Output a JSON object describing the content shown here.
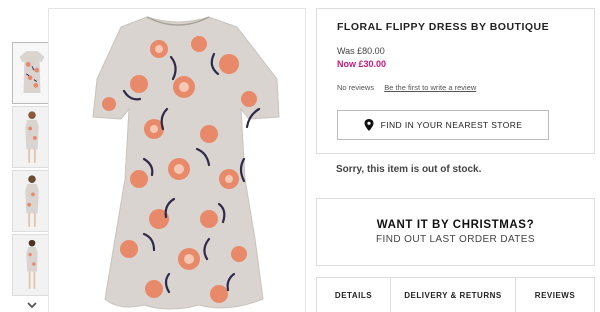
{
  "product": {
    "title": "FLORAL FLIPPY DRESS BY BOUTIQUE",
    "was_price": "Was £80.00",
    "now_price": "Now £30.00",
    "reviews_text": "No reviews",
    "review_link": "Be the first to write a review",
    "store_button": "FIND IN YOUR NEAREST STORE",
    "stock_message": "Sorry, this item is out of stock."
  },
  "promo": {
    "title": "WANT IT BY CHRISTMAS?",
    "subtitle": "FIND OUT LAST ORDER DATES"
  },
  "tabs": [
    {
      "label": "DETAILS"
    },
    {
      "label": "DELIVERY & RETURNS"
    },
    {
      "label": "REVIEWS"
    }
  ],
  "colors": {
    "sale_price": "#c1197a",
    "dress_base": "#d9d4cf",
    "flower_coral": "#e8896a",
    "flower_navy": "#2f2a4a"
  },
  "icons": {
    "store_button": "map-pin-icon",
    "thumb_scroll": "chevron-down-icon"
  }
}
